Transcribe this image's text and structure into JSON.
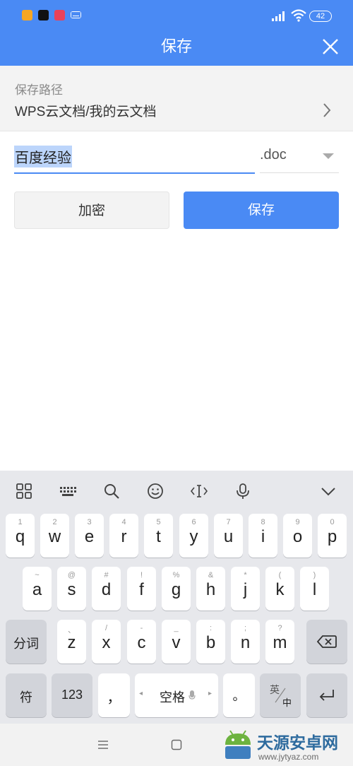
{
  "status": {
    "battery": "42"
  },
  "header": {
    "title": "保存"
  },
  "path": {
    "label": "保存路径",
    "value": "WPS云文档/我的云文档"
  },
  "file": {
    "name": "百度经验",
    "extension": ".doc"
  },
  "buttons": {
    "encrypt": "加密",
    "save": "保存"
  },
  "keyboard": {
    "row1": [
      {
        "hint": "1",
        "ch": "q"
      },
      {
        "hint": "2",
        "ch": "w"
      },
      {
        "hint": "3",
        "ch": "e"
      },
      {
        "hint": "4",
        "ch": "r"
      },
      {
        "hint": "5",
        "ch": "t"
      },
      {
        "hint": "6",
        "ch": "y"
      },
      {
        "hint": "7",
        "ch": "u"
      },
      {
        "hint": "8",
        "ch": "i"
      },
      {
        "hint": "9",
        "ch": "o"
      },
      {
        "hint": "0",
        "ch": "p"
      }
    ],
    "row2": [
      {
        "hint": "~",
        "ch": "a"
      },
      {
        "hint": "@",
        "ch": "s"
      },
      {
        "hint": "#",
        "ch": "d"
      },
      {
        "hint": "!",
        "ch": "f"
      },
      {
        "hint": "%",
        "ch": "g"
      },
      {
        "hint": "&",
        "ch": "h"
      },
      {
        "hint": "*",
        "ch": "j"
      },
      {
        "hint": "(",
        "ch": "k"
      },
      {
        "hint": ")",
        "ch": "l"
      }
    ],
    "row3": [
      {
        "hint": "、",
        "ch": "z"
      },
      {
        "hint": "/",
        "ch": "x"
      },
      {
        "hint": "-",
        "ch": "c"
      },
      {
        "hint": "_",
        "ch": "v"
      },
      {
        "hint": ":",
        "ch": "b"
      },
      {
        "hint": ";",
        "ch": "n"
      },
      {
        "hint": "?",
        "ch": "m"
      }
    ],
    "segment_label": "分词",
    "symbol_label": "符",
    "numeric_label": "123",
    "comma_label": "，",
    "space_label": "空格",
    "period_label": "。",
    "lang_top": "英",
    "lang_bottom": "中"
  },
  "watermark": {
    "title": "天源安卓网",
    "url": "www.jytyaz.com"
  },
  "colors": {
    "accent": "#4a8af4",
    "keyboard_bg": "#e7e8ec"
  }
}
